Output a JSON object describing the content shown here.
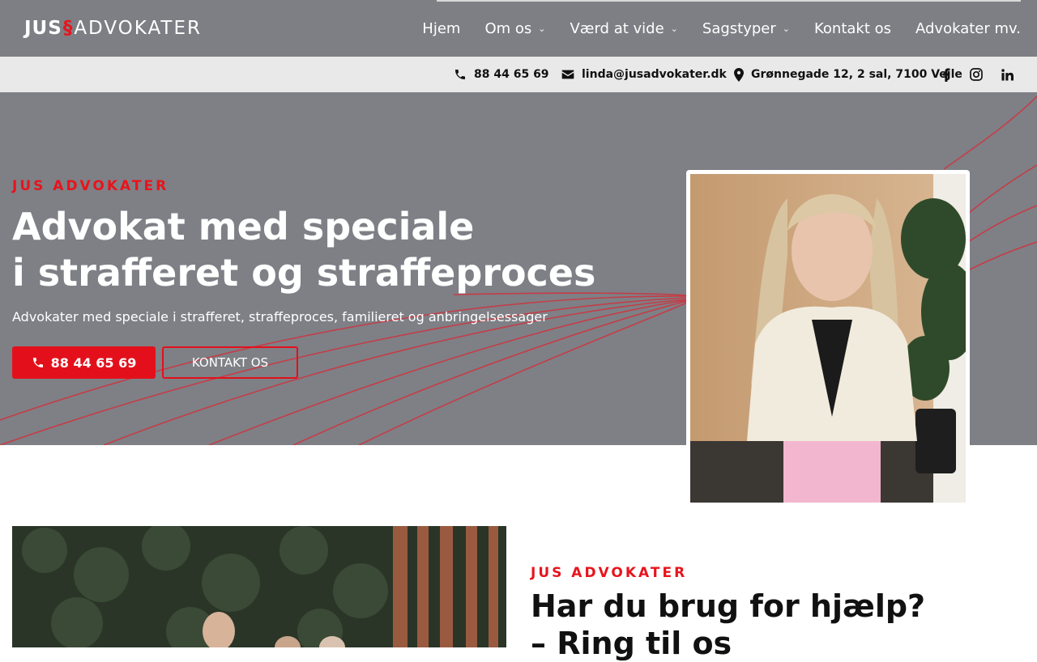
{
  "header": {
    "logo": {
      "part1": "JUS",
      "mark": "§",
      "part2": "ADVOKATER"
    },
    "nav": [
      {
        "label": "Hjem",
        "has_dropdown": false
      },
      {
        "label": "Om os",
        "has_dropdown": true
      },
      {
        "label": "Værd at vide",
        "has_dropdown": true
      },
      {
        "label": "Sagstyper",
        "has_dropdown": true
      },
      {
        "label": "Kontakt os",
        "has_dropdown": false
      },
      {
        "label": "Advokater mv.",
        "has_dropdown": false
      }
    ]
  },
  "infobar": {
    "phone": "88 44 65 69",
    "email": "linda@jusadvokater.dk",
    "address": "Grønnegade 12, 2 sal, 7100 Vejle",
    "social": [
      "facebook-icon",
      "instagram-icon",
      "linkedin-icon"
    ]
  },
  "hero": {
    "eyebrow": "JUS ADVOKATER",
    "title_line1": "Advokat med speciale",
    "title_line2": "i strafferet og straffeproces",
    "subtitle": "Advokater med speciale i strafferet, straffeproces, familieret og anbringelsessager",
    "call_button": "88 44 65 69",
    "contact_button": "KONTAKT OS"
  },
  "section2": {
    "eyebrow": "JUS ADVOKATER",
    "title_line1": "Har du brug for hjælp?",
    "title_line2": "– Ring til os"
  },
  "colors": {
    "brand_red": "#e3101b",
    "header_gray": "#7d7f85",
    "infobar_bg": "#e9e9e9"
  }
}
